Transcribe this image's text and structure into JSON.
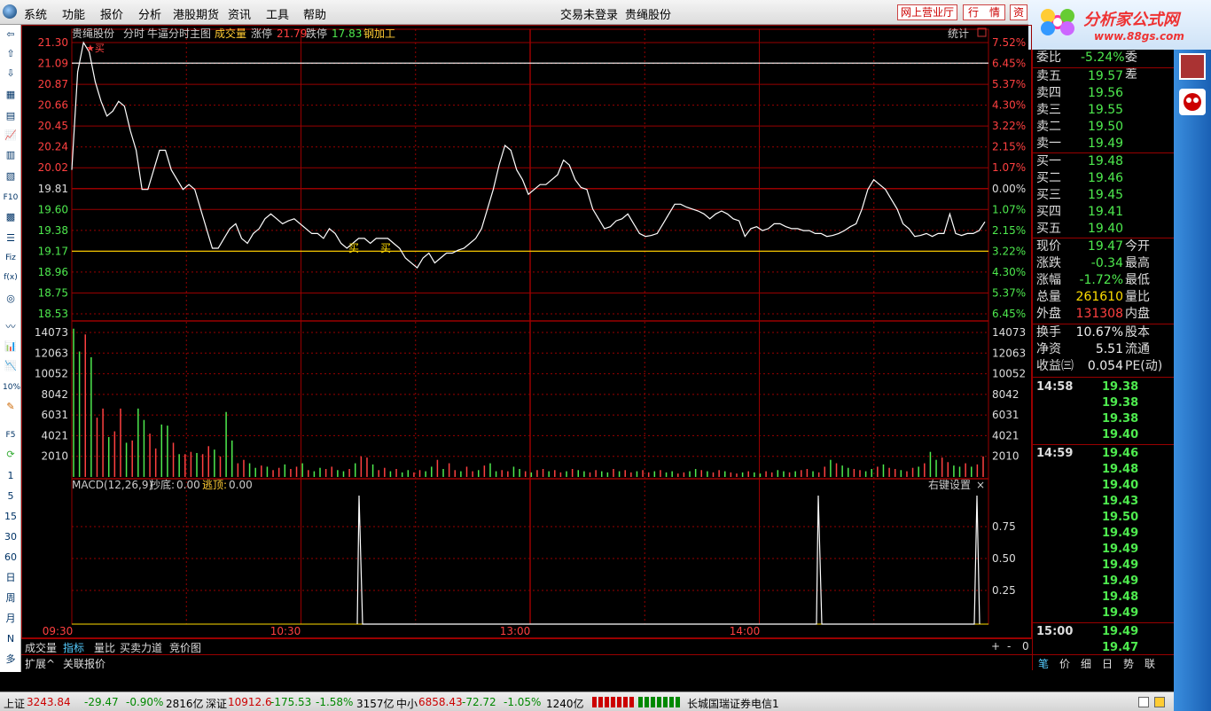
{
  "menubar": {
    "items": [
      "系统",
      "功能",
      "报价",
      "分析",
      "港股期货",
      "资讯",
      "工具",
      "帮助"
    ],
    "center_status": "交易未登录",
    "center_stock": "贵绳股份",
    "btn_online": "网上营业厅",
    "btn_quote": "行　情",
    "btn_asset": "资"
  },
  "banner": {
    "title": "分析家公式网",
    "url": "www.88gs.com"
  },
  "chart_header": {
    "stock": "贵绳股份",
    "mode": "分时",
    "main": "牛逼分时主图",
    "vol_label": "成交量",
    "limit_up_label": "涨停",
    "limit_up": "21.79",
    "limit_down_label": "跌停",
    "limit_down": "17.83",
    "sector": "钢加工",
    "stats": "统计"
  },
  "price_axis": {
    "left": [
      "21.30",
      "21.09",
      "20.87",
      "20.66",
      "20.45",
      "20.24",
      "20.02",
      "19.81",
      "19.60",
      "19.38",
      "19.17",
      "18.96",
      "18.75",
      "18.53"
    ],
    "right": [
      "7.52%",
      "6.45%",
      "5.37%",
      "4.30%",
      "3.22%",
      "2.15%",
      "1.07%",
      "0.00%",
      "1.07%",
      "2.15%",
      "3.22%",
      "4.30%",
      "5.37%",
      "6.45%"
    ]
  },
  "vol_axis": [
    "14073",
    "12063",
    "10052",
    "8042",
    "6031",
    "4021",
    "2010"
  ],
  "macd": {
    "label": "MACD(12,26,9)",
    "bottom_label": "抄底:",
    "bottom_val": "0.00",
    "top_label": "逃顶:",
    "top_val": "0.00",
    "settings": "右键设置",
    "close": "×",
    "axis": [
      "0.75",
      "0.50",
      "0.25"
    ]
  },
  "signals": {
    "buy": "买"
  },
  "time_axis": [
    "09:30",
    "10:30",
    "13:00",
    "14:00"
  ],
  "chart_data": {
    "type": "line",
    "title": "贵绳股份 分时",
    "prev_close": 19.81,
    "ylim": [
      18.53,
      21.3
    ],
    "yellow_line": 19.17,
    "white_line": 21.09,
    "price": [
      20.0,
      21.0,
      21.3,
      21.2,
      20.9,
      20.7,
      20.55,
      20.6,
      20.7,
      20.65,
      20.4,
      20.2,
      19.8,
      19.8,
      20.0,
      20.2,
      20.2,
      20.0,
      19.9,
      19.8,
      19.85,
      19.8,
      19.6,
      19.4,
      19.2,
      19.2,
      19.3,
      19.4,
      19.45,
      19.3,
      19.25,
      19.35,
      19.4,
      19.5,
      19.55,
      19.5,
      19.45,
      19.48,
      19.5,
      19.45,
      19.4,
      19.35,
      19.35,
      19.3,
      19.4,
      19.35,
      19.25,
      19.2,
      19.25,
      19.3,
      19.3,
      19.25,
      19.3,
      19.3,
      19.3,
      19.25,
      19.2,
      19.1,
      19.05,
      19.0,
      19.1,
      19.15,
      19.05,
      19.1,
      19.15,
      19.15,
      19.18,
      19.2,
      19.25,
      19.3,
      19.4,
      19.6,
      19.8,
      20.05,
      20.25,
      20.2,
      20.0,
      19.9,
      19.75,
      19.8,
      19.85,
      19.85,
      19.9,
      19.95,
      20.1,
      20.05,
      19.9,
      19.82,
      19.8,
      19.6,
      19.5,
      19.4,
      19.42,
      19.48,
      19.5,
      19.55,
      19.45,
      19.35,
      19.32,
      19.33,
      19.35,
      19.45,
      19.55,
      19.65,
      19.65,
      19.62,
      19.6,
      19.58,
      19.55,
      19.5,
      19.55,
      19.58,
      19.55,
      19.5,
      19.48,
      19.32,
      19.4,
      19.42,
      19.38,
      19.4,
      19.45,
      19.45,
      19.42,
      19.4,
      19.4,
      19.38,
      19.38,
      19.35,
      19.35,
      19.32,
      19.33,
      19.35,
      19.38,
      19.42,
      19.45,
      19.6,
      19.8,
      19.9,
      19.85,
      19.8,
      19.7,
      19.6,
      19.45,
      19.4,
      19.32,
      19.33,
      19.35,
      19.32,
      19.35,
      19.35,
      19.55,
      19.35,
      19.33,
      19.35,
      19.35,
      19.38,
      19.47
    ],
    "volume": [
      13000,
      11000,
      12500,
      10500,
      5200,
      6000,
      3500,
      4000,
      6000,
      3000,
      3200,
      6000,
      5000,
      3800,
      2500,
      4600,
      4500,
      3000,
      2000,
      2000,
      2200,
      2100,
      2000,
      2700,
      2400,
      1800,
      5700,
      3200,
      1200,
      1500,
      1200,
      800,
      1000,
      900,
      600,
      800,
      1100,
      700,
      900,
      1200,
      600,
      500,
      800,
      700,
      900,
      600,
      500,
      700,
      1200,
      1800,
      1700,
      1100,
      600,
      800,
      500,
      700,
      400,
      600,
      400,
      600,
      500,
      900,
      1500,
      700,
      1200,
      600,
      500,
      900,
      500,
      600,
      1000,
      1200,
      500,
      600,
      500,
      900,
      700,
      500,
      400,
      600,
      700,
      500,
      600,
      400,
      500,
      700,
      600,
      500,
      400,
      600,
      500,
      400,
      700,
      500,
      600,
      400,
      500,
      600,
      400,
      500,
      600,
      400,
      500,
      300,
      400,
      500,
      700,
      600,
      500,
      400,
      600,
      500,
      400,
      300,
      400,
      500,
      400,
      300,
      500,
      400,
      600,
      500,
      400,
      500,
      600,
      700,
      500,
      400,
      900,
      1500,
      1200,
      1000,
      800,
      700,
      600,
      500,
      700,
      900,
      1100,
      800,
      700,
      600,
      500,
      800,
      900,
      1200,
      2200,
      1500,
      1700,
      1300,
      1000,
      900,
      1200,
      900,
      1100,
      1800
    ]
  },
  "right_panel": {
    "weibi_label": "委比",
    "weibi": "-5.24%",
    "weicha_label": "委差",
    "sell": [
      {
        "label": "卖五",
        "price": "19.57"
      },
      {
        "label": "卖四",
        "price": "19.56"
      },
      {
        "label": "卖三",
        "price": "19.55"
      },
      {
        "label": "卖二",
        "price": "19.50"
      },
      {
        "label": "卖一",
        "price": "19.49"
      }
    ],
    "buy": [
      {
        "label": "买一",
        "price": "19.48"
      },
      {
        "label": "买二",
        "price": "19.46"
      },
      {
        "label": "买三",
        "price": "19.45"
      },
      {
        "label": "买四",
        "price": "19.41"
      },
      {
        "label": "买五",
        "price": "19.40"
      }
    ],
    "stats": [
      {
        "l": "现价",
        "v": "19.47",
        "r": "今开"
      },
      {
        "l": "涨跌",
        "v": "-0.34",
        "r": "最高"
      },
      {
        "l": "涨幅",
        "v": "-1.72%",
        "r": "最低"
      },
      {
        "l": "总量",
        "v": "261610",
        "r": "量比"
      },
      {
        "l": "外盘",
        "v": "131308",
        "r": "内盘"
      }
    ],
    "stats2": [
      {
        "l": "换手",
        "v": "10.67%",
        "r": "股本"
      },
      {
        "l": "净资",
        "v": "5.51",
        "r": "流通"
      },
      {
        "l": "收益㈢",
        "v": "0.054",
        "r": "PE(动)"
      }
    ],
    "ticks": [
      {
        "time": "14:58",
        "prices": [
          "19.38",
          "19.38",
          "19.38",
          "19.40"
        ]
      },
      {
        "time": "14:59",
        "prices": [
          "19.46",
          "19.48",
          "19.40",
          "19.43",
          "19.50",
          "19.49",
          "19.49",
          "19.49",
          "19.49",
          "19.48",
          "19.49"
        ]
      },
      {
        "time": "15:00",
        "prices": [
          "19.49",
          "19.47"
        ]
      }
    ],
    "tabs": [
      "笔",
      "价",
      "细",
      "日",
      "势",
      "联"
    ]
  },
  "left_toolbar": [
    "1",
    "5",
    "15",
    "30",
    "60",
    "日",
    "周",
    "月",
    "N",
    "多"
  ],
  "bottom_tabs": [
    "成交量",
    "指标",
    "量比",
    "买卖力道",
    "竞价图"
  ],
  "bottom_tabs2": [
    "扩展^",
    "关联报价"
  ],
  "bottom_ctrl": [
    "+",
    "-",
    "0"
  ],
  "statusbar": {
    "sh_label": "上证",
    "sh": "3243.84",
    "sh_chg": "-29.47",
    "sh_pct": "-0.90%",
    "sh_amt": "2816亿",
    "sz_label": "深证",
    "sz": "10912.6",
    "sz_chg": "-175.53",
    "sz_pct": "-1.58%",
    "sz_amt": "3157亿",
    "zx_label": "中小",
    "zx": "6858.43",
    "zx_chg": "-72.72",
    "zx_pct": "-1.05%",
    "zx_amt": "1240亿",
    "broker": "长城国瑞证券电信1"
  }
}
